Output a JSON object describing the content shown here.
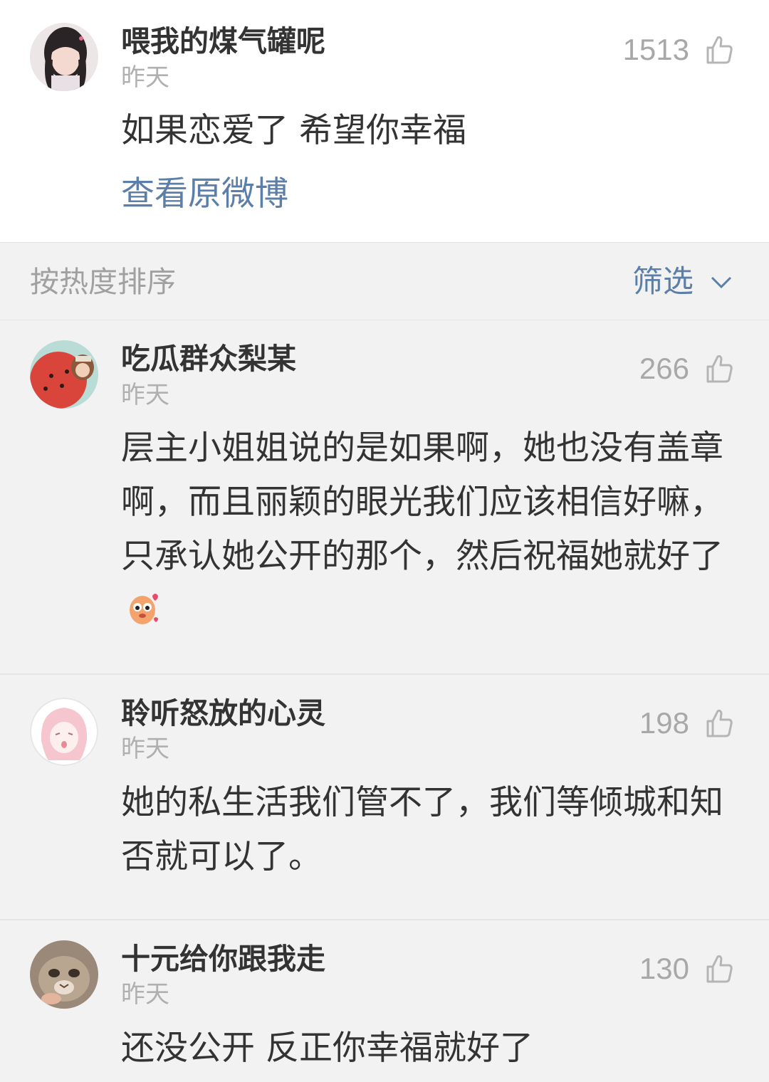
{
  "root": {
    "username": "喂我的煤气罐呢",
    "time": "昨天",
    "likes": "1513",
    "text": "如果恋爱了 希望你幸福",
    "view_original": "查看原微博"
  },
  "sort_bar": {
    "label": "按热度排序",
    "filter_label": "筛选"
  },
  "comments": [
    {
      "username": "吃瓜群众梨某",
      "time": "昨天",
      "likes": "266",
      "text": "层主小姐姐说的是如果啊，她也没有盖章啊，而且丽颖的眼光我们应该相信好嘛，只承认她公开的那个，然后祝福她就好了"
    },
    {
      "username": "聆听怒放的心灵",
      "time": "昨天",
      "likes": "198",
      "text": "她的私生活我们管不了，我们等倾城和知否就可以了。"
    },
    {
      "username": "十元给你跟我走",
      "time": "昨天",
      "likes": "130",
      "text": "还没公开 反正你幸福就好了"
    }
  ],
  "colors": {
    "link_blue": "#5b7fa8",
    "muted_gray": "#a8a8a8",
    "page_bg": "#f2f2f2"
  },
  "icons": {
    "like": "thumbs-up-icon",
    "filter": "chevron-down-icon"
  }
}
